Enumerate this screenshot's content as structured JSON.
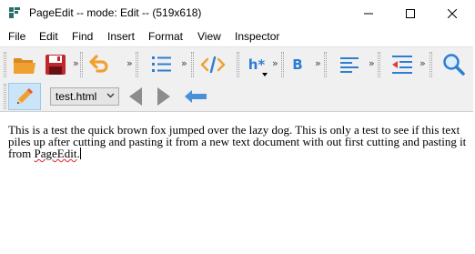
{
  "window": {
    "title": "PageEdit -- mode: Edit -- (519x618)"
  },
  "menu": {
    "items": [
      "File",
      "Edit",
      "Find",
      "Insert",
      "Format",
      "View",
      "Inspector"
    ]
  },
  "toolbar": {
    "more_glyph": "»",
    "heading_label": "h*",
    "bold_label": "B",
    "code_label": "</>"
  },
  "navigation": {
    "file_select_value": "test.html"
  },
  "editor": {
    "text_before": "This is a test the quick brown fox jumped over the lazy dog. This is only a test to see if this text piles up after cutting and pasting it from a new text document with out first cutting and pasting it from ",
    "misspelled_word": "PageEdit",
    "text_after": "."
  },
  "colors": {
    "orange_icon": "#f0a030",
    "red_icon": "#c0282d",
    "blue_icon": "#2d7dd2",
    "gray_nav": "#8c8c8c",
    "spell_underline": "#e02020"
  }
}
